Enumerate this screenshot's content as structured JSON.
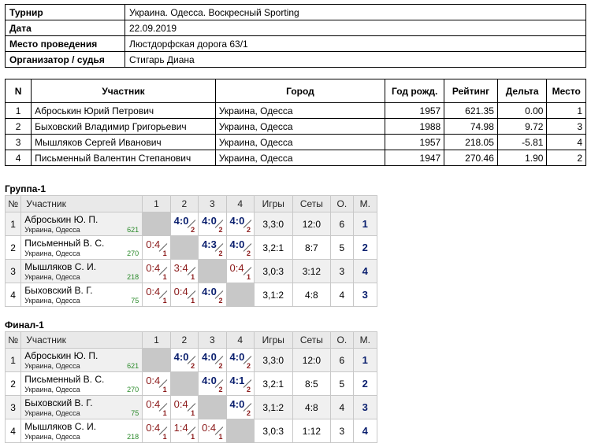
{
  "info": [
    {
      "key": "Турнир",
      "value": "Украина. Одесса. Воскресный Sporting"
    },
    {
      "key": "Дата",
      "value": "22.09.2019"
    },
    {
      "key": "Место проведения",
      "value": "Люстдорфская дорога 63/1"
    },
    {
      "key": "Организатор / судья",
      "value": "Стигарь Диана"
    }
  ],
  "participants": {
    "headers": [
      "N",
      "Участник",
      "Город",
      "Год рожд.",
      "Рейтинг",
      "Дельта",
      "Место"
    ],
    "rows": [
      [
        "1",
        "Аброськин Юрий Петрович",
        "Украина, Одесса",
        "1957",
        "621.35",
        "0.00",
        "1"
      ],
      [
        "2",
        "Быховский Владимир Григорьевич",
        "Украина, Одесса",
        "1988",
        "74.98",
        "9.72",
        "3"
      ],
      [
        "3",
        "Мышляков Сергей Иванович",
        "Украина, Одесса",
        "1957",
        "218.05",
        "-5.81",
        "4"
      ],
      [
        "4",
        "Письменный Валентин Степанович",
        "Украина, Одесса",
        "1947",
        "270.46",
        "1.90",
        "2"
      ]
    ]
  },
  "groups": [
    {
      "title": "Группа-1",
      "headers": [
        "№",
        "Участник",
        "1",
        "2",
        "3",
        "4",
        "Игры",
        "Сеты",
        "О.",
        "М."
      ],
      "rows": [
        {
          "n": "1",
          "name": "Аброськин Ю. П.",
          "city": "Украина, Одесса",
          "rating": "621",
          "cells": [
            null,
            {
              "s": "4:0",
              "p": "2",
              "w": true
            },
            {
              "s": "4:0",
              "p": "2",
              "w": true
            },
            {
              "s": "4:0",
              "p": "2",
              "w": true
            }
          ],
          "games": "3,3:0",
          "sets": "12:0",
          "pts": "6",
          "place": "1"
        },
        {
          "n": "2",
          "name": "Письменный В. С.",
          "city": "Украина, Одесса",
          "rating": "270",
          "cells": [
            {
              "s": "0:4",
              "p": "1",
              "w": false
            },
            null,
            {
              "s": "4:3",
              "p": "2",
              "w": true
            },
            {
              "s": "4:0",
              "p": "2",
              "w": true
            }
          ],
          "games": "3,2:1",
          "sets": "8:7",
          "pts": "5",
          "place": "2"
        },
        {
          "n": "3",
          "name": "Мышляков С. И.",
          "city": "Украина, Одесса",
          "rating": "218",
          "cells": [
            {
              "s": "0:4",
              "p": "1",
              "w": false
            },
            {
              "s": "3:4",
              "p": "1",
              "w": false
            },
            null,
            {
              "s": "0:4",
              "p": "1",
              "w": false
            }
          ],
          "games": "3,0:3",
          "sets": "3:12",
          "pts": "3",
          "place": "4"
        },
        {
          "n": "4",
          "name": "Быховский В. Г.",
          "city": "Украина, Одесса",
          "rating": "75",
          "cells": [
            {
              "s": "0:4",
              "p": "1",
              "w": false
            },
            {
              "s": "0:4",
              "p": "1",
              "w": false
            },
            {
              "s": "4:0",
              "p": "2",
              "w": true
            },
            null
          ],
          "games": "3,1:2",
          "sets": "4:8",
          "pts": "4",
          "place": "3"
        }
      ]
    },
    {
      "title": "Финал-1",
      "headers": [
        "№",
        "Участник",
        "1",
        "2",
        "3",
        "4",
        "Игры",
        "Сеты",
        "О.",
        "М."
      ],
      "rows": [
        {
          "n": "1",
          "name": "Аброськин Ю. П.",
          "city": "Украина, Одесса",
          "rating": "621",
          "cells": [
            null,
            {
              "s": "4:0",
              "p": "2",
              "w": true
            },
            {
              "s": "4:0",
              "p": "2",
              "w": true
            },
            {
              "s": "4:0",
              "p": "2",
              "w": true
            }
          ],
          "games": "3,3:0",
          "sets": "12:0",
          "pts": "6",
          "place": "1"
        },
        {
          "n": "2",
          "name": "Письменный В. С.",
          "city": "Украина, Одесса",
          "rating": "270",
          "cells": [
            {
              "s": "0:4",
              "p": "1",
              "w": false
            },
            null,
            {
              "s": "4:0",
              "p": "2",
              "w": true
            },
            {
              "s": "4:1",
              "p": "2",
              "w": true
            }
          ],
          "games": "3,2:1",
          "sets": "8:5",
          "pts": "5",
          "place": "2"
        },
        {
          "n": "3",
          "name": "Быховский В. Г.",
          "city": "Украина, Одесса",
          "rating": "75",
          "cells": [
            {
              "s": "0:4",
              "p": "1",
              "w": false
            },
            {
              "s": "0:4",
              "p": "1",
              "w": false
            },
            null,
            {
              "s": "4:0",
              "p": "2",
              "w": true
            }
          ],
          "games": "3,1:2",
          "sets": "4:8",
          "pts": "4",
          "place": "3"
        },
        {
          "n": "4",
          "name": "Мышляков С. И.",
          "city": "Украина, Одесса",
          "rating": "218",
          "cells": [
            {
              "s": "0:4",
              "p": "1",
              "w": false
            },
            {
              "s": "1:4",
              "p": "1",
              "w": false
            },
            {
              "s": "0:4",
              "p": "1",
              "w": false
            },
            null
          ],
          "games": "3,0:3",
          "sets": "1:12",
          "pts": "3",
          "place": "4"
        }
      ]
    }
  ]
}
